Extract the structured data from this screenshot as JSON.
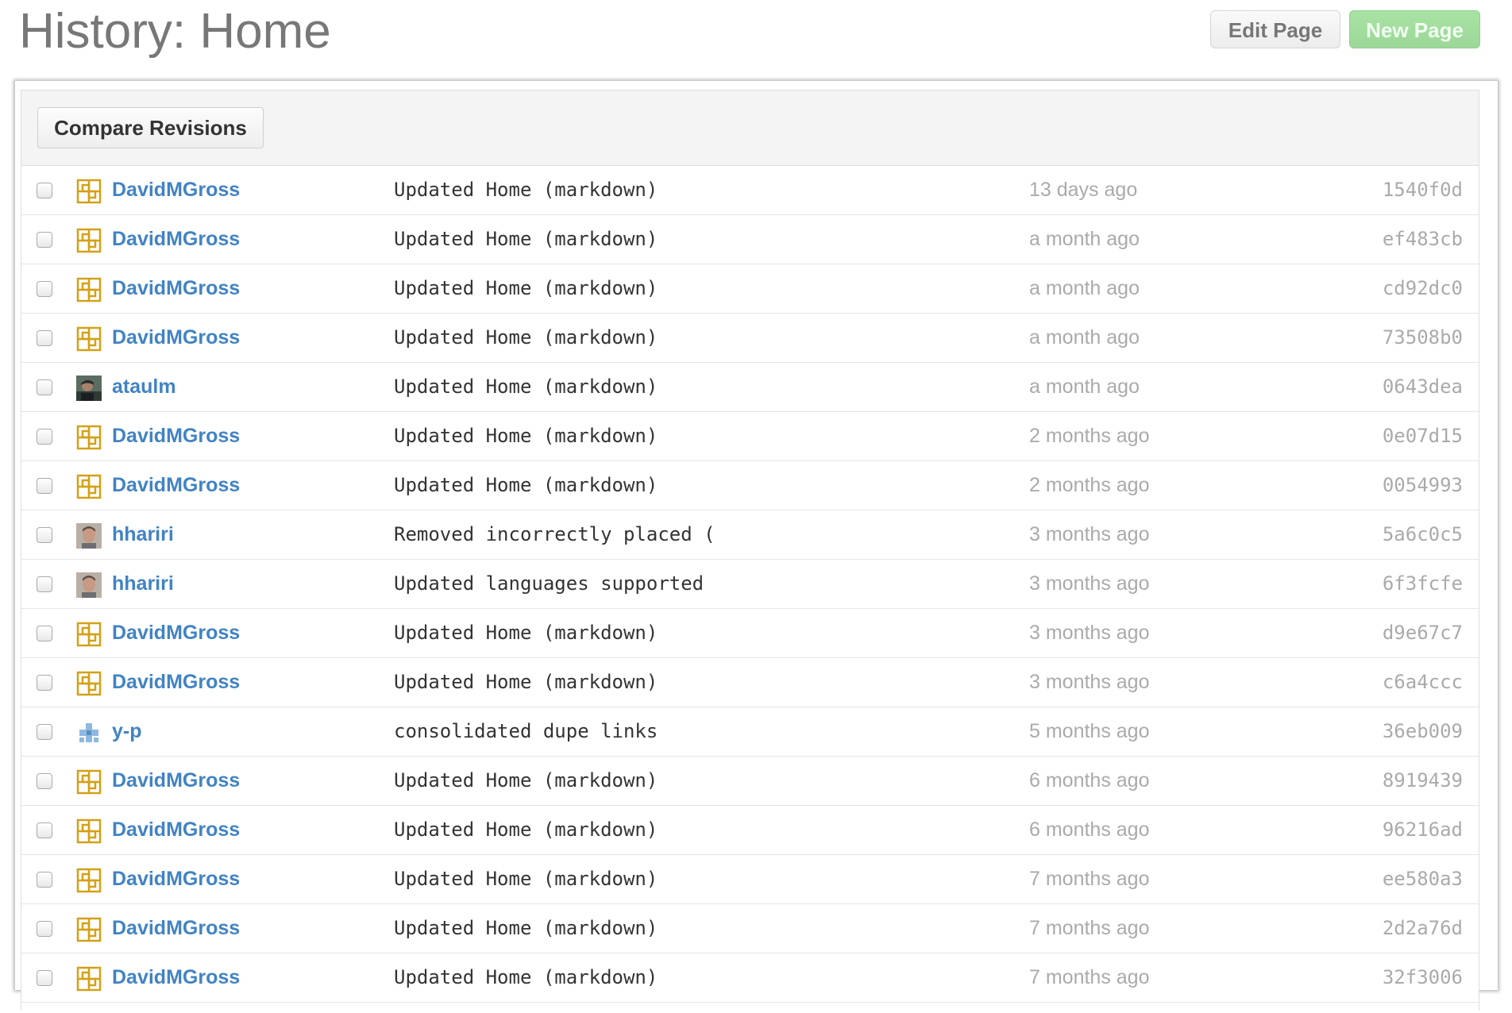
{
  "header": {
    "title": "History: Home",
    "edit_page_label": "Edit Page",
    "new_page_label": "New Page"
  },
  "toolbar": {
    "compare_label": "Compare Revisions"
  },
  "colors": {
    "link": "#4183c4",
    "muted": "#aaaaaa",
    "new_page_button": "#9cd798",
    "identicon_gold": "#d4a017"
  },
  "revisions": [
    {
      "author": "DavidMGross",
      "avatar": "identicon-gold",
      "message": "Updated Home (markdown)",
      "time": "13 days ago",
      "sha": "1540f0d"
    },
    {
      "author": "DavidMGross",
      "avatar": "identicon-gold",
      "message": "Updated Home (markdown)",
      "time": "a month ago",
      "sha": "ef483cb"
    },
    {
      "author": "DavidMGross",
      "avatar": "identicon-gold",
      "message": "Updated Home (markdown)",
      "time": "a month ago",
      "sha": "cd92dc0"
    },
    {
      "author": "DavidMGross",
      "avatar": "identicon-gold",
      "message": "Updated Home (markdown)",
      "time": "a month ago",
      "sha": "73508b0"
    },
    {
      "author": "ataulm",
      "avatar": "photo",
      "message": "Updated Home (markdown)",
      "time": "a month ago",
      "sha": "0643dea"
    },
    {
      "author": "DavidMGross",
      "avatar": "identicon-gold",
      "message": "Updated Home (markdown)",
      "time": "2 months ago",
      "sha": "0e07d15"
    },
    {
      "author": "DavidMGross",
      "avatar": "identicon-gold",
      "message": "Updated Home (markdown)",
      "time": "2 months ago",
      "sha": "0054993"
    },
    {
      "author": "hhariri",
      "avatar": "photo",
      "message": "Removed incorrectly placed (",
      "time": "3 months ago",
      "sha": "5a6c0c5"
    },
    {
      "author": "hhariri",
      "avatar": "photo",
      "message": "Updated languages supported",
      "time": "3 months ago",
      "sha": "6f3fcfe"
    },
    {
      "author": "DavidMGross",
      "avatar": "identicon-gold",
      "message": "Updated Home (markdown)",
      "time": "3 months ago",
      "sha": "d9e67c7"
    },
    {
      "author": "DavidMGross",
      "avatar": "identicon-gold",
      "message": "Updated Home (markdown)",
      "time": "3 months ago",
      "sha": "c6a4ccc"
    },
    {
      "author": "y-p",
      "avatar": "identicon-blue",
      "message": "consolidated dupe links",
      "time": "5 months ago",
      "sha": "36eb009"
    },
    {
      "author": "DavidMGross",
      "avatar": "identicon-gold",
      "message": "Updated Home (markdown)",
      "time": "6 months ago",
      "sha": "8919439"
    },
    {
      "author": "DavidMGross",
      "avatar": "identicon-gold",
      "message": "Updated Home (markdown)",
      "time": "6 months ago",
      "sha": "96216ad"
    },
    {
      "author": "DavidMGross",
      "avatar": "identicon-gold",
      "message": "Updated Home (markdown)",
      "time": "7 months ago",
      "sha": "ee580a3"
    },
    {
      "author": "DavidMGross",
      "avatar": "identicon-gold",
      "message": "Updated Home (markdown)",
      "time": "7 months ago",
      "sha": "2d2a76d"
    },
    {
      "author": "DavidMGross",
      "avatar": "identicon-gold",
      "message": "Updated Home (markdown)",
      "time": "7 months ago",
      "sha": "32f3006"
    }
  ]
}
